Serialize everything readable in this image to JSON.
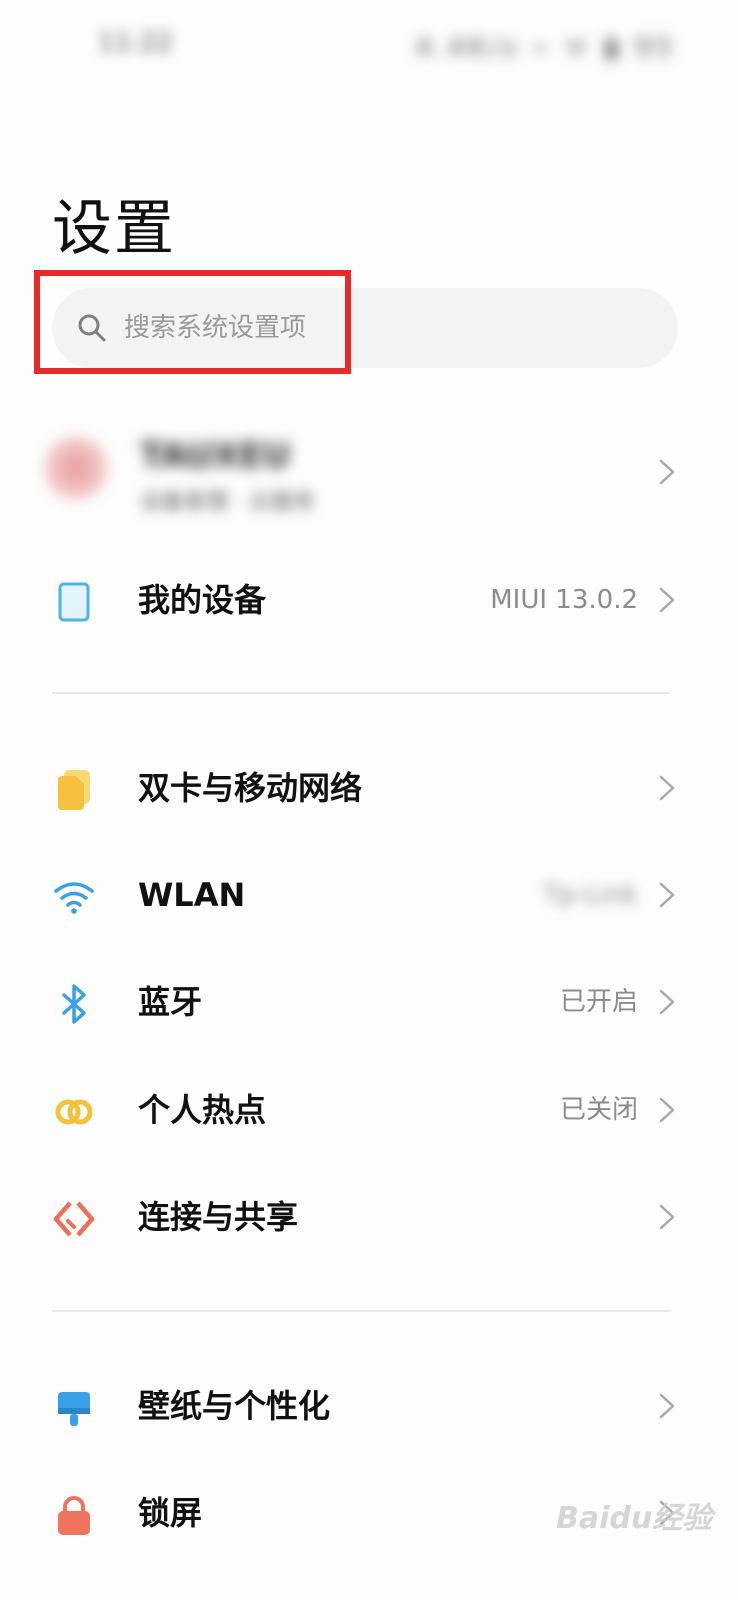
{
  "status_bar": {
    "time": "11:22",
    "icons": "4.4K/s ⌁ ᯤ ▮ 95"
  },
  "header": {
    "title": "设置"
  },
  "search": {
    "placeholder": "搜索系统设置项"
  },
  "account": {
    "name": "TAUXEU",
    "subtitle": "设备管理 · 云服务"
  },
  "rows": [
    {
      "id": "my-device",
      "label": "我的设备",
      "value": "MIUI 13.0.2",
      "icon": "tablet-icon",
      "color": "#4db3e6"
    },
    {
      "id": "dual-sim",
      "label": "双卡与移动网络",
      "value": "",
      "icon": "sim-card-icon",
      "color": "#f6c13c"
    },
    {
      "id": "wlan",
      "label": "WLAN",
      "value": "Tp-Link",
      "icon": "wifi-icon",
      "color": "#3aa0e8"
    },
    {
      "id": "bluetooth",
      "label": "蓝牙",
      "value": "已开启",
      "icon": "bluetooth-icon",
      "color": "#3aa0e8"
    },
    {
      "id": "hotspot",
      "label": "个人热点",
      "value": "已关闭",
      "icon": "hotspot-icon",
      "color": "#f2c23a"
    },
    {
      "id": "connection-share",
      "label": "连接与共享",
      "value": "",
      "icon": "share-icon",
      "color": "#ee6f57"
    },
    {
      "id": "wallpaper",
      "label": "壁纸与个性化",
      "value": "",
      "icon": "brush-icon",
      "color": "#3aa0e8"
    },
    {
      "id": "lock-screen",
      "label": "锁屏",
      "value": "",
      "icon": "lock-icon",
      "color": "#f0735d"
    }
  ],
  "watermark": "Baidu经验"
}
